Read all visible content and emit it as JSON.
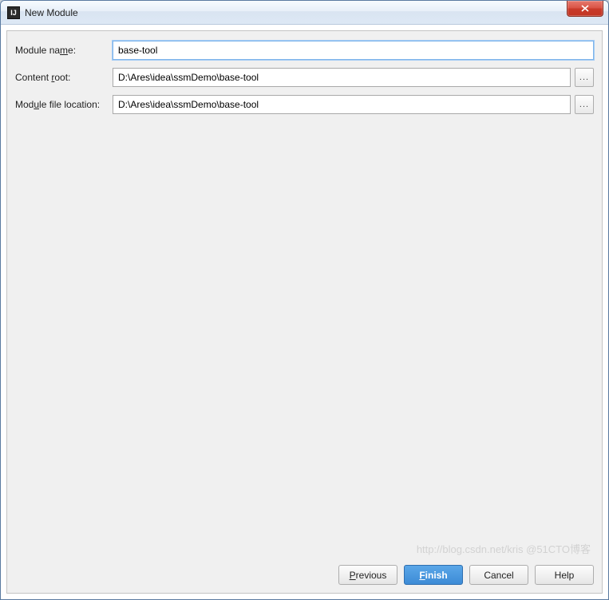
{
  "window": {
    "title": "New Module",
    "icon": "IJ"
  },
  "form": {
    "module_name": {
      "label_pre": "Module na",
      "mn": "m",
      "label_post": "e:",
      "value": "base-tool"
    },
    "content_root": {
      "label_pre": "Content ",
      "mn": "r",
      "label_post": "oot:",
      "value": "D:\\Ares\\idea\\ssmDemo\\base-tool"
    },
    "module_file_location": {
      "label_pre": "Mod",
      "mn": "u",
      "label_post": "le file location:",
      "value": "D:\\Ares\\idea\\ssmDemo\\base-tool"
    },
    "browse_label": "..."
  },
  "buttons": {
    "previous": {
      "mn": "P",
      "rest": "revious"
    },
    "finish": {
      "mn": "F",
      "rest": "inish"
    },
    "cancel": "Cancel",
    "help": "Help"
  },
  "watermark": "http://blog.csdn.net/kris @51CTO博客"
}
